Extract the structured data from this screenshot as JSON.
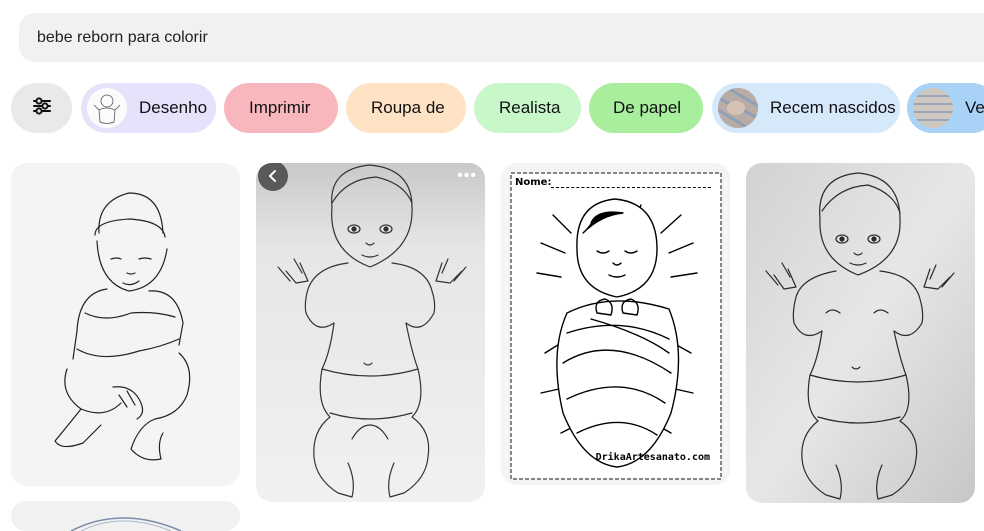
{
  "search": {
    "query": "bebe reborn para colorir"
  },
  "filters": [
    {
      "label": "Desenho",
      "bg": "#e6e2fb"
    },
    {
      "label": "Imprimir",
      "bg": "#f7b7bd"
    },
    {
      "label": "Roupa de",
      "bg": "#fde3c4"
    },
    {
      "label": "Realista",
      "bg": "#c8f7c9"
    },
    {
      "label": "De papel",
      "bg": "#a8ee9d"
    },
    {
      "label": "Recem nascidos",
      "bg": "#d6e9fb"
    },
    {
      "label": "Ves",
      "bg": "#a9d2f7"
    }
  ],
  "cards": {
    "swaddle_name_label": "Nome:",
    "swaddle_watermark": "DrikaArtesanato.com"
  },
  "icons": {
    "filter": "sliders-icon",
    "back": "chevron-left-icon",
    "more": "more-dots-icon"
  }
}
